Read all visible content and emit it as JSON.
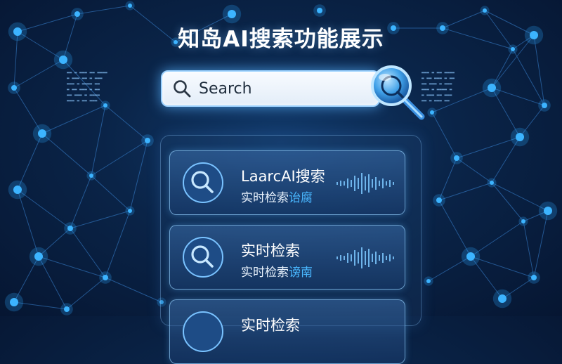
{
  "page": {
    "title": "知岛AI搜索功能展示"
  },
  "search": {
    "placeholder": "Search",
    "icon": "search-icon",
    "submit_icon": "magnifier-icon"
  },
  "results": [
    {
      "title": "LaarcAI搜索",
      "subtitle": "实时检索",
      "highlight": "诒腐",
      "icon": "search-icon"
    },
    {
      "title": "实时检索",
      "subtitle": "实时检索",
      "highlight": "谤南",
      "icon": "search-icon"
    },
    {
      "title": "实时检索",
      "subtitle": "",
      "highlight": "",
      "icon": "search-icon"
    }
  ],
  "colors": {
    "background": "#0a2448",
    "node": "#2aa8ff",
    "accent": "#49b7ff",
    "search_border": "#9dd2ff"
  }
}
